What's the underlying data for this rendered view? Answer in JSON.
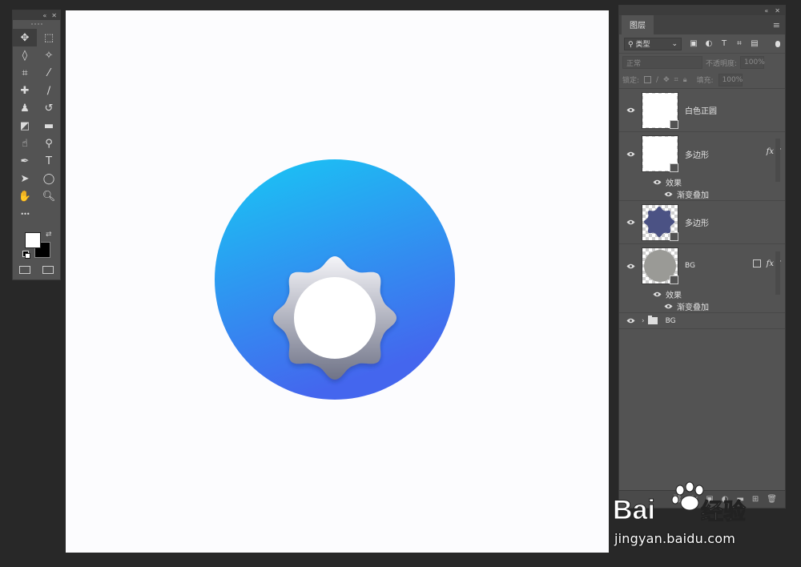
{
  "tools_panel": {
    "header_icons": [
      "collapse-icon",
      "close-icon"
    ],
    "tools": [
      {
        "name": "move-tool",
        "glyph": "✥"
      },
      {
        "name": "marquee-tool",
        "glyph": "⬚"
      },
      {
        "name": "lasso-tool",
        "glyph": "◊"
      },
      {
        "name": "magic-wand-tool",
        "glyph": "✧"
      },
      {
        "name": "crop-tool",
        "glyph": "⌗"
      },
      {
        "name": "eyedropper-tool",
        "glyph": "⁄"
      },
      {
        "name": "healing-brush-tool",
        "glyph": "✚"
      },
      {
        "name": "brush-tool",
        "glyph": "∕"
      },
      {
        "name": "clone-stamp-tool",
        "glyph": "♟"
      },
      {
        "name": "history-brush-tool",
        "glyph": "↺"
      },
      {
        "name": "eraser-tool",
        "glyph": "◩"
      },
      {
        "name": "gradient-tool",
        "glyph": "▬"
      },
      {
        "name": "smudge-tool",
        "glyph": "☝"
      },
      {
        "name": "dodge-tool",
        "glyph": "⚲"
      },
      {
        "name": "pen-tool",
        "glyph": "✒"
      },
      {
        "name": "type-tool",
        "glyph": "T"
      },
      {
        "name": "path-select-tool",
        "glyph": "➤"
      },
      {
        "name": "ellipse-tool",
        "glyph": "◯"
      },
      {
        "name": "hand-tool",
        "glyph": "✋"
      },
      {
        "name": "zoom-tool",
        "glyph": "🔍︎"
      },
      {
        "name": "more-tools",
        "glyph": "•••"
      }
    ],
    "foreground_color": "#ffffff",
    "background_color": "#000000"
  },
  "canvas": {
    "background": "#fcfcfe",
    "circle_gradient_top": "#18c8f4",
    "circle_gradient_bottom": "#4466ee",
    "badge_gradient_top": "#f4f4f8",
    "badge_gradient_bottom": "#6f7387",
    "inner_circle": "#ffffff"
  },
  "layers_panel": {
    "tab_label": "图层",
    "filter_label": "类型",
    "blend_mode": "正常",
    "opacity_label": "不透明度:",
    "opacity_value": "100%",
    "lock_label": "锁定:",
    "fill_label": "填充:",
    "fill_value": "100%",
    "layers": [
      {
        "name": "白色正圆",
        "thumb": "white",
        "fx": false
      },
      {
        "name": "多边形",
        "thumb": "white",
        "fx": true,
        "effects_label": "效果",
        "effect": "渐变叠加"
      },
      {
        "name": "多边形",
        "thumb": "navy-star",
        "fx": false
      },
      {
        "name": "BG",
        "thumb": "gray-circle",
        "fx": true,
        "effects_label": "效果",
        "effect": "渐变叠加"
      }
    ],
    "group": {
      "name": "BG"
    },
    "fx_label": "fx"
  },
  "watermark": {
    "brand_left": "Bai",
    "brand_right": "经验",
    "url": "jingyan.baidu.com"
  }
}
